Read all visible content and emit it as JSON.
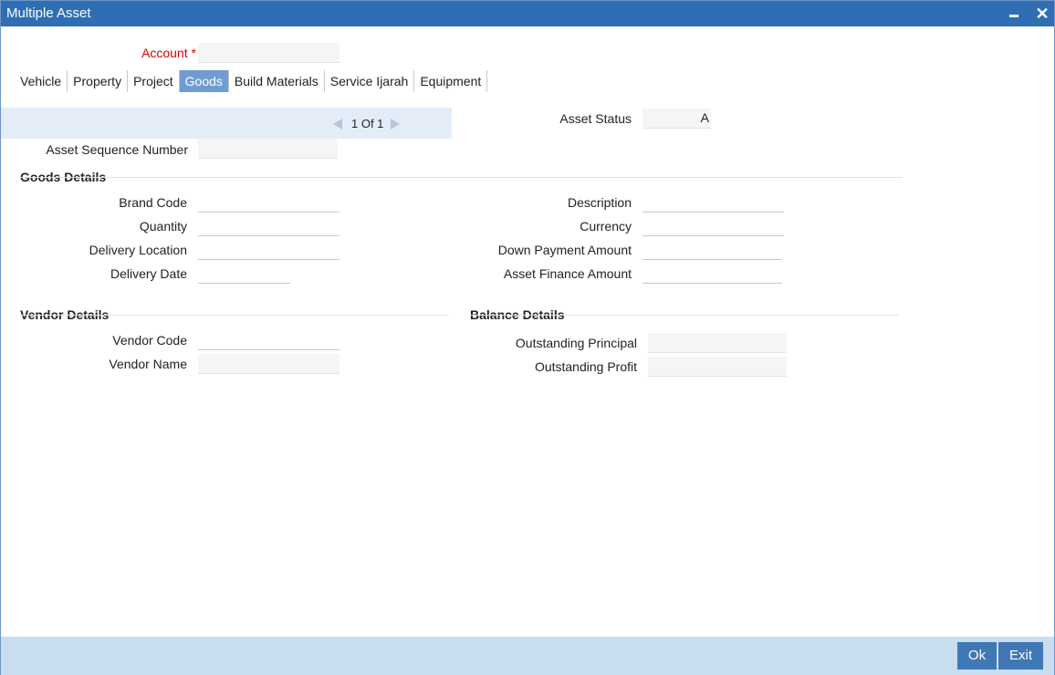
{
  "window": {
    "title": "Multiple Asset",
    "minimize_icon": "minimize-icon",
    "close_icon": "close-icon",
    "close_glyph": "✕"
  },
  "account": {
    "label": "Account",
    "required_mark": "*",
    "value": ""
  },
  "tabs": [
    {
      "label": "Vehicle",
      "active": false
    },
    {
      "label": "Property",
      "active": false
    },
    {
      "label": "Project",
      "active": false
    },
    {
      "label": "Goods",
      "active": true
    },
    {
      "label": "Build Materials",
      "active": false
    },
    {
      "label": "Service Ijarah",
      "active": false
    },
    {
      "label": "Equipment",
      "active": false
    }
  ],
  "pager": {
    "text": "1 Of 1",
    "prev_icon": "chevron-left-icon",
    "next_icon": "chevron-right-icon"
  },
  "asset_status": {
    "label": "Asset Status",
    "value": "A"
  },
  "asset_sequence": {
    "label": "Asset Sequence Number",
    "value": ""
  },
  "goods_details": {
    "title": "Goods Details",
    "brand_code": {
      "label": "Brand Code",
      "value": ""
    },
    "quantity": {
      "label": "Quantity",
      "value": ""
    },
    "delivery_location": {
      "label": "Delivery Location",
      "value": ""
    },
    "delivery_date": {
      "label": "Delivery Date",
      "value": ""
    },
    "description": {
      "label": "Description",
      "value": ""
    },
    "currency": {
      "label": "Currency",
      "value": ""
    },
    "down_payment": {
      "label": "Down Payment Amount",
      "value": ""
    },
    "asset_finance": {
      "label": "Asset Finance Amount",
      "value": ""
    }
  },
  "vendor_details": {
    "title": "Vendor Details",
    "vendor_code": {
      "label": "Vendor Code",
      "value": ""
    },
    "vendor_name": {
      "label": "Vendor Name",
      "value": ""
    }
  },
  "balance_details": {
    "title": "Balance Details",
    "outstanding_principal": {
      "label": "Outstanding Principal",
      "value": ""
    },
    "outstanding_profit": {
      "label": "Outstanding Profit",
      "value": ""
    }
  },
  "footer": {
    "ok_label": "Ok",
    "exit_label": "Exit"
  },
  "colors": {
    "titlebar": "#2f6eb5",
    "active_tab": "#6f9dd2",
    "footer": "#c8ddef",
    "button": "#3f78b5",
    "required": "#dd0000"
  }
}
